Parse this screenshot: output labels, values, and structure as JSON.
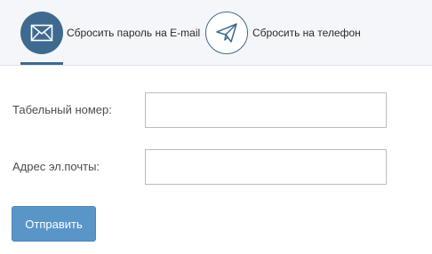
{
  "tabs": {
    "email": {
      "label": "Сбросить пароль на E-mail",
      "icon": "envelope-icon",
      "active": true
    },
    "phone": {
      "label": "Сбросить на телефон",
      "icon": "paper-plane-icon",
      "active": false
    }
  },
  "form": {
    "employee_number": {
      "label": "Табельный номер:",
      "value": "",
      "placeholder": ""
    },
    "email_address": {
      "label": "Адрес эл.почты:",
      "value": "",
      "placeholder": ""
    }
  },
  "submit_label": "Отправить",
  "colors": {
    "accent": "#3f6a8f",
    "button": "#5a95c8",
    "tabbar_bg": "#f4f6f9",
    "input_border": "#b8bec5"
  }
}
